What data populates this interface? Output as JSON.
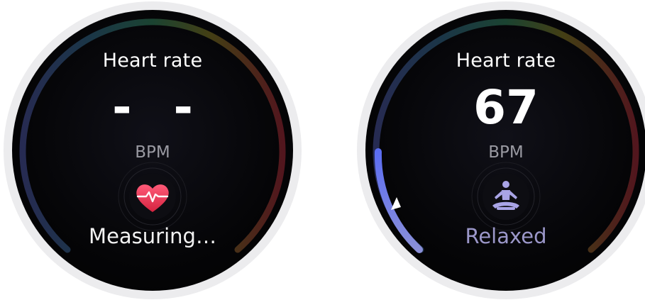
{
  "screens": [
    {
      "title": "Heart rate",
      "bpm_value": "- -",
      "bpm_unit": "BPM",
      "status": "Measuring…",
      "center_icon": "heart-pulse-icon",
      "status_color": "#f2f2f2"
    },
    {
      "title": "Heart rate",
      "bpm_value": "67",
      "bpm_unit": "BPM",
      "status": "Relaxed",
      "center_icon": "meditation-person-icon",
      "status_color": "#9b97c9"
    }
  ],
  "colors": {
    "heart": "#e8385a",
    "zone_blue": "#5a6cf0",
    "zone_green": "#1f6a4a",
    "zone_yellow": "#6a5a12",
    "zone_red": "#6a1a22"
  }
}
